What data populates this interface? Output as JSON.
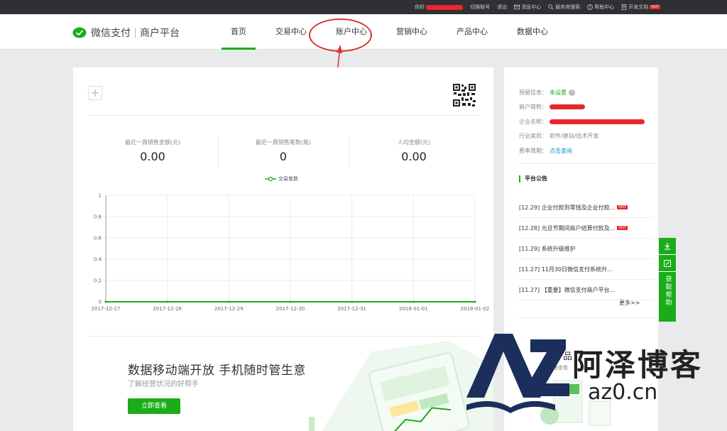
{
  "topbar": {
    "greeting": "你好",
    "switch_account": "切换账号",
    "logout": "退出",
    "messages": "消息中心",
    "service_search": "服务商搜索",
    "help": "帮助中心",
    "dev_docs": "开发文档",
    "hot_badge": "HOT"
  },
  "header": {
    "brand": "微信支付",
    "platform": "商户平台",
    "tabs": [
      {
        "label": "首页"
      },
      {
        "label": "交易中心"
      },
      {
        "label": "账户中心"
      },
      {
        "label": "营销中心"
      },
      {
        "label": "产品中心"
      },
      {
        "label": "数据中心"
      }
    ]
  },
  "stats": [
    {
      "label": "最近一周销售金额(元)",
      "value": "0.00"
    },
    {
      "label": "最近一周销售笔数(笔)",
      "value": "0"
    },
    {
      "label": "人均金额(元)",
      "value": "0.00"
    }
  ],
  "chart_data": {
    "type": "line",
    "x": [
      "2017-12-27",
      "2017-12-28",
      "2017-12-29",
      "2017-12-30",
      "2017-12-31",
      "2018-01-01",
      "2018-01-02"
    ],
    "series": [
      {
        "name": "交易笔数",
        "values": [
          0,
          0,
          0,
          0,
          0,
          0,
          0
        ]
      }
    ],
    "yticks": [
      "1",
      "0.8",
      "0.6",
      "0.4",
      "0.2",
      "0"
    ],
    "ylim": [
      0,
      1
    ],
    "grid": true,
    "legend": "top-center",
    "color": "#1aad19"
  },
  "promo": {
    "title": "数据移动端开放 手机随时管生意",
    "subtitle": "了解经营状况的好帮手",
    "button": "立即查看"
  },
  "merchant_info": {
    "pre_info_label": "预留信息：",
    "pre_info_value": "未设置",
    "short_name_label": "商户简称：",
    "company_name_label": "企业名称：",
    "industry_label": "行业类目：",
    "industry_value": "软件/建站/技术开发",
    "rate_period_label": "费率周期：",
    "rate_period_value": "点击查询"
  },
  "notices": {
    "title": "平台公告",
    "items": [
      {
        "text": "[12.29] 企业付款到零钱及企业付款...",
        "hot": true
      },
      {
        "text": "[12.28] 元旦节期间商户结算付款及...",
        "hot": true
      },
      {
        "text": "[11.29] 系统升级维护",
        "hot": false
      },
      {
        "text": "[11.27] 11月30日微信支付系统升...",
        "hot": false
      },
      {
        "text": "[11.27] 【重要】微信支付商户平台...",
        "hot": false
      }
    ],
    "more": "更多>>",
    "hot_badge": "HOT"
  },
  "side_promo": {
    "title": "产品",
    "subtitle": "快速查看"
  },
  "float_toolbar": {
    "help_label": "获取帮助"
  },
  "watermark": {
    "brand": "阿泽博客",
    "url": "az0.cn"
  },
  "colors": {
    "accent": "#1aad19",
    "topbar": "#2e3033",
    "annotation": "#d9342b"
  }
}
